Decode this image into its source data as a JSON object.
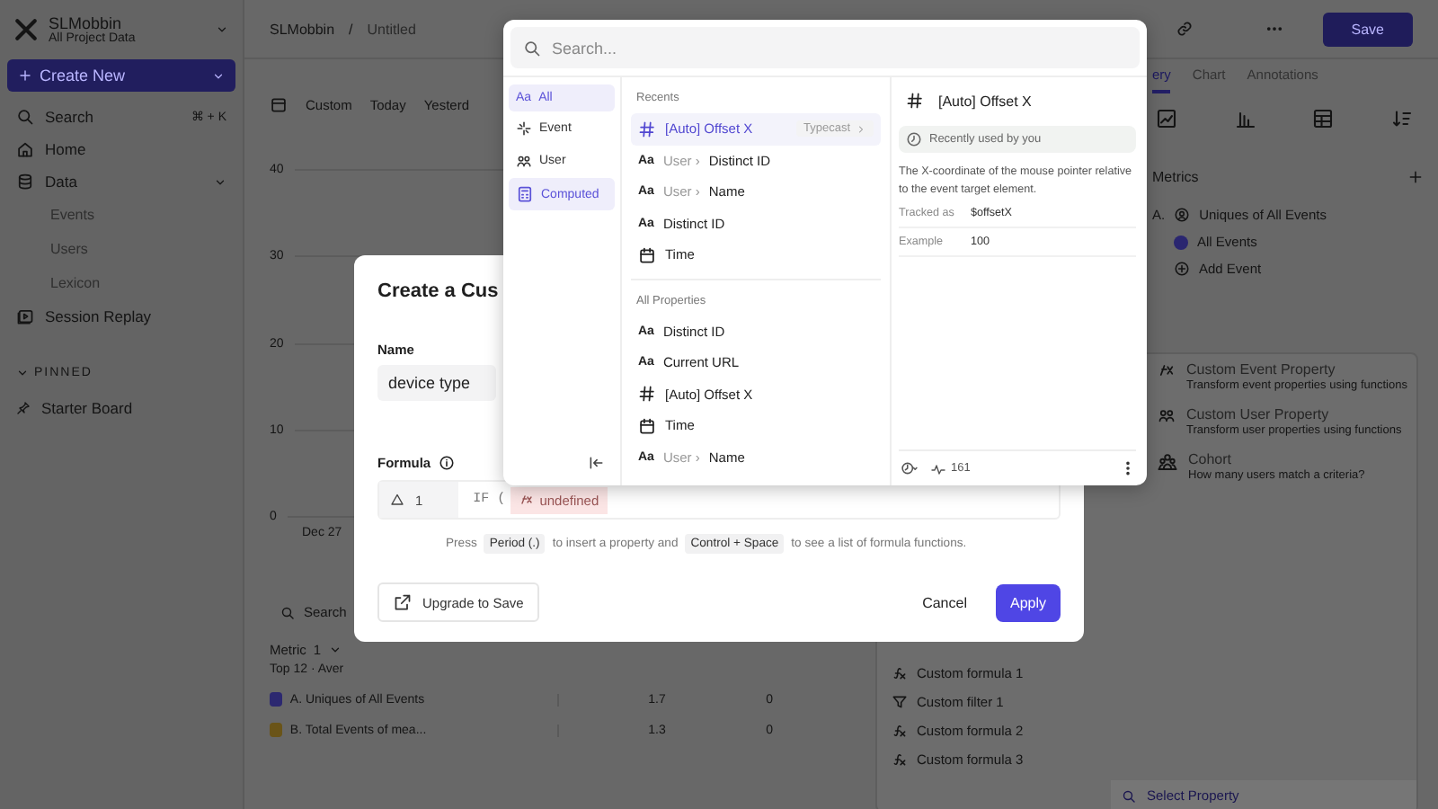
{
  "sidebar": {
    "workspace": "SLMobbin",
    "subtitle": "All Project Data",
    "create_button": "Create New",
    "items": [
      {
        "kind": "search",
        "label": "Search",
        "shortcut": "⌘ + K"
      },
      {
        "kind": "home",
        "label": "Home"
      },
      {
        "kind": "data",
        "label": "Data",
        "expanded": true,
        "children": [
          {
            "label": "Events"
          },
          {
            "label": "Users"
          },
          {
            "label": "Lexicon"
          }
        ]
      },
      {
        "kind": "replay",
        "label": "Session Replay"
      }
    ],
    "pinned": {
      "heading": "PINNED",
      "expanded": true,
      "items": [
        {
          "label": "Starter Board"
        }
      ]
    }
  },
  "header": {
    "workspace": "SLMobbin",
    "separator": "/",
    "page": "Untitled",
    "save": "Save"
  },
  "date_tabs": [
    "Custom",
    "Today",
    "Yesterd"
  ],
  "chart": {
    "y_labels": [
      "40",
      "30",
      "20",
      "10",
      "0"
    ],
    "x_label": "Dec 27"
  },
  "table": {
    "search_placeholder": "Search",
    "metric_header": "Metric",
    "metric_count": "1",
    "subheader": "Top 12 · Aver",
    "rows": [
      {
        "label": "A. Uniques of All Events",
        "color": "#2c2870",
        "value": "1.7",
        "change": "0"
      },
      {
        "label": "B. Total Events of mea...",
        "color": "#6a5418",
        "value": "1.3",
        "change": "0"
      }
    ]
  },
  "right_panel": {
    "tabs": [
      {
        "label": "ery",
        "selected": true
      },
      {
        "label": "Chart",
        "selected": false
      },
      {
        "label": "Annotations",
        "selected": false
      }
    ],
    "metrics_heading": "Metrics",
    "metric_letter": "A.",
    "metric_label": "Uniques of All Events",
    "event": "All Events",
    "add_event": "Add Event"
  },
  "menu": {
    "items": [
      {
        "kind": "event",
        "title": "Custom Event Property",
        "description": "Transform event properties using functions"
      },
      {
        "kind": "user",
        "title": "Custom User Property",
        "description": "Transform user properties using functions"
      },
      {
        "kind": "cohort",
        "title": "Cohort",
        "description": "How many users match a criteria?"
      }
    ],
    "custom_items": [
      {
        "kind": "formula",
        "label": "Custom formula 1"
      },
      {
        "kind": "filter",
        "label": "Custom filter 1"
      },
      {
        "kind": "formula",
        "label": "Custom formula 2"
      },
      {
        "kind": "formula",
        "label": "Custom formula 3"
      }
    ],
    "search_placeholder": "Select Property"
  },
  "dialog": {
    "title": "Create a Cus",
    "name_label": "Name",
    "name_value": "device type",
    "formula_label": "Formula",
    "formula": {
      "line": "1",
      "code": "IF (",
      "token": "undefined"
    },
    "hint": [
      {
        "kind": "text",
        "text": "Press"
      },
      {
        "kind": "key",
        "text": "Period (.)"
      },
      {
        "kind": "text",
        "text": "to insert a property and"
      },
      {
        "kind": "key",
        "text": "Control + Space"
      },
      {
        "kind": "text",
        "text": "to see a list of formula functions."
      }
    ],
    "upgrade": "Upgrade to Save",
    "cancel": "Cancel",
    "apply": "Apply"
  },
  "picker": {
    "search_placeholder": "Search...",
    "categories": [
      {
        "kind": "all",
        "glyph": "Aa",
        "label": "All",
        "selected": true
      },
      {
        "kind": "event",
        "label": "Event",
        "selected": false
      },
      {
        "kind": "user",
        "label": "User",
        "selected": false
      },
      {
        "kind": "computed",
        "label": "Computed",
        "selected": true
      }
    ],
    "sections": [
      {
        "heading": "Recents",
        "items": [
          {
            "kind": "number",
            "name": "[Auto] Offset X",
            "highlighted": true,
            "badge": "Typecast"
          },
          {
            "kind": "text",
            "glyph": "Aa",
            "parent": "User",
            "separator": "›",
            "name": "Distinct ID",
            "highlighted": false
          },
          {
            "kind": "text",
            "glyph": "Aa",
            "parent": "User",
            "separator": "›",
            "name": "Name",
            "highlighted": false
          },
          {
            "kind": "text",
            "glyph": "Aa",
            "name": "Distinct ID",
            "highlighted": false
          },
          {
            "kind": "date",
            "name": "Time",
            "highlighted": false
          }
        ]
      },
      {
        "heading": "All Properties",
        "items": [
          {
            "kind": "text",
            "glyph": "Aa",
            "name": "Distinct ID",
            "highlighted": false
          },
          {
            "kind": "text",
            "glyph": "Aa",
            "name": "Current URL",
            "highlighted": false
          },
          {
            "kind": "number",
            "name": "[Auto] Offset X",
            "highlighted": false
          },
          {
            "kind": "date",
            "name": "Time",
            "highlighted": false
          },
          {
            "kind": "text",
            "glyph": "Aa",
            "parent": "User",
            "separator": "›",
            "name": "Name",
            "highlighted": false
          }
        ]
      }
    ],
    "detail": {
      "kind": "number",
      "title": "[Auto] Offset X",
      "recent": "Recently used by you",
      "description": "The X-coordinate of the mouse pointer relative to the event target element.",
      "fields": [
        {
          "label": "Tracked as",
          "value": "$offsetX"
        },
        {
          "label": "Example",
          "value": "100"
        }
      ],
      "count": "161"
    }
  }
}
